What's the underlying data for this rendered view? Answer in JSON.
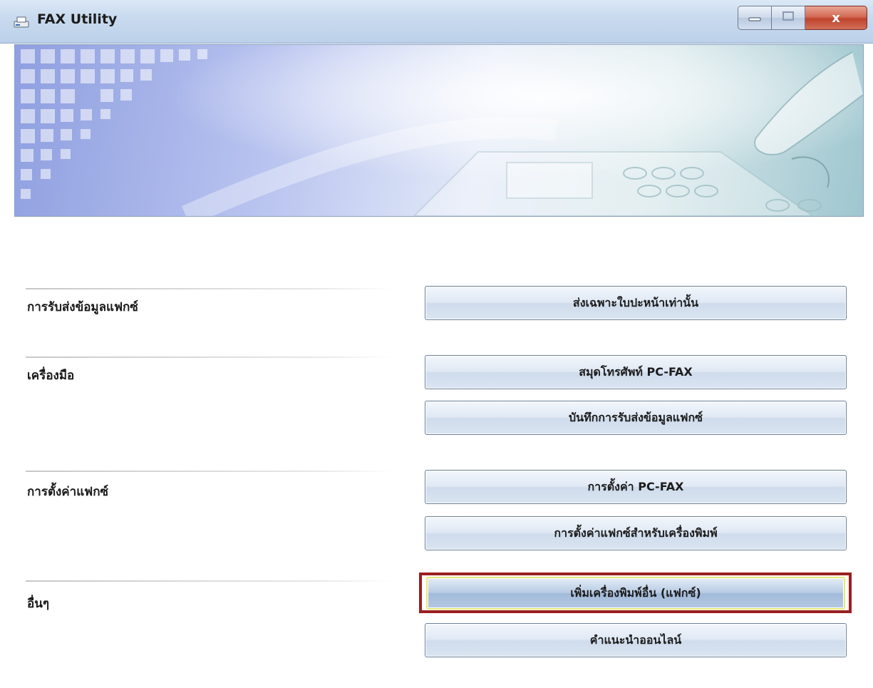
{
  "window": {
    "title": "FAX Utility",
    "controls": {
      "close_glyph": "x"
    }
  },
  "icons": {
    "app": "fax-machine-icon",
    "minimize": "minimize-icon",
    "maximize": "maximize-icon",
    "close": "close-icon"
  },
  "sections": [
    {
      "label": "การรับส่งข้อมูลแฟกซ์",
      "buttons": [
        "ส่งเฉพาะใบปะหน้าเท่านั้น"
      ]
    },
    {
      "label": "เครื่องมือ",
      "buttons": [
        "สมุดโทรศัพท์ PC-FAX",
        "บันทึกการรับส่งข้อมูลแฟกซ์"
      ]
    },
    {
      "label": "การตั้งค่าแฟกซ์",
      "buttons": [
        "การตั้งค่า PC-FAX",
        "การตั้งค่าแฟกซ์สำหรับเครื่องพิมพ์"
      ]
    },
    {
      "label": "อื่นๆ",
      "buttons": [
        "เพิ่มเครื่องพิมพ์อื่น (แฟกซ์)",
        "คำแนะนำออนไลน์"
      ]
    }
  ],
  "highlighted_button": "เพิ่มเครื่องพิมพ์อื่น (แฟกซ์)",
  "colors": {
    "highlight_frame": "#9a1f1f",
    "close_button": "#c0432b"
  }
}
